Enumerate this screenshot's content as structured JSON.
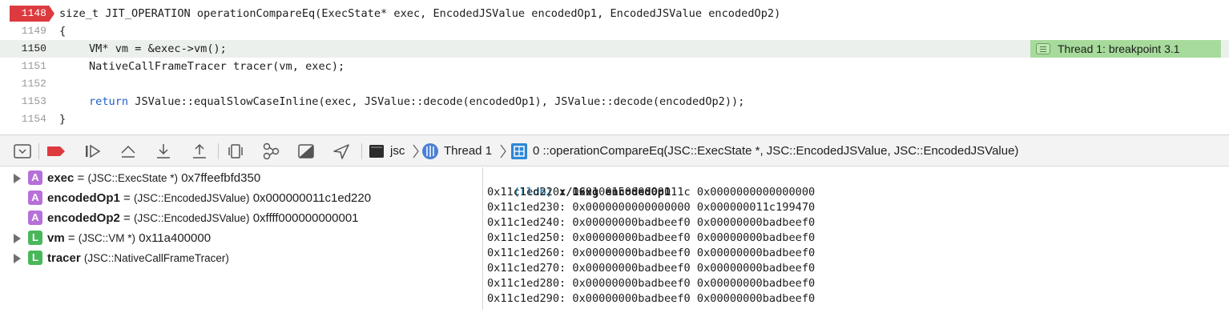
{
  "editor": {
    "breakpoint_line": "1148",
    "lines": [
      {
        "number": "1148",
        "text": "size_t JIT_OPERATION operationCompareEq(ExecState* exec, EncodedJSValue encodedOp1, EncodedJSValue encodedOp2)"
      },
      {
        "number": "1149",
        "text": "{"
      },
      {
        "number": "1150",
        "text": "VM* vm = &exec->vm();"
      },
      {
        "number": "1151",
        "text": "NativeCallFrameTracer tracer(vm, exec);"
      },
      {
        "number": "1152",
        "text": ""
      },
      {
        "number": "1153",
        "keyword": "return",
        "text": " JSValue::equalSlowCaseInline(exec, JSValue::decode(encodedOp1), JSValue::decode(encodedOp2));"
      },
      {
        "number": "1154",
        "text": "}"
      }
    ],
    "annotation": "Thread 1: breakpoint 3.1"
  },
  "debug_bar": {
    "buttons": [
      "hide-debug-area-icon",
      "breakpoints-toggle-icon",
      "continue-icon",
      "step-over-icon",
      "step-into-icon",
      "step-out-icon",
      "view-hierarchy-icon",
      "memory-graph-icon",
      "environment-overrides-icon",
      "simulate-location-icon"
    ],
    "breadcrumb": {
      "target": "jsc",
      "thread": "Thread 1",
      "frame": "0 ::operationCompareEq(JSC::ExecState *, JSC::EncodedJSValue, JSC::EncodedJSValue)"
    },
    "colors": {
      "breakpoint": "#dc3a3f",
      "thread_icon": "#4a7fd4",
      "frame_icon": "#2f86d6"
    }
  },
  "variables": [
    {
      "badge": "A",
      "name": "exec",
      "eq": " = ",
      "type": "(JSC::ExecState *)",
      "value": " 0x7ffeefbfd350",
      "expandable": true
    },
    {
      "badge": "A",
      "name": "encodedOp1",
      "eq": " = ",
      "type": "(JSC::EncodedJSValue)",
      "value": " 0x000000011c1ed220",
      "expandable": false
    },
    {
      "badge": "A",
      "name": "encodedOp2",
      "eq": " = ",
      "type": "(JSC::EncodedJSValue)",
      "value": " 0xffff000000000001",
      "expandable": false
    },
    {
      "badge": "L",
      "name": "vm",
      "eq": " = ",
      "type": "(JSC::VM *)",
      "value": " 0x11a400000",
      "expandable": true
    },
    {
      "badge": "L",
      "name": "tracer",
      "eq": " ",
      "type": "(JSC::NativeCallFrameTracer)",
      "value": "",
      "expandable": true
    }
  ],
  "console": {
    "prompt": "(lldb)",
    "command": " x/16xg encodedOp1",
    "output": [
      "0x11c1ed220: 0x010015000000011c 0x0000000000000000",
      "0x11c1ed230: 0x0000000000000000 0x000000011c199470",
      "0x11c1ed240: 0x00000000badbeef0 0x00000000badbeef0",
      "0x11c1ed250: 0x00000000badbeef0 0x00000000badbeef0",
      "0x11c1ed260: 0x00000000badbeef0 0x00000000badbeef0",
      "0x11c1ed270: 0x00000000badbeef0 0x00000000badbeef0",
      "0x11c1ed280: 0x00000000badbeef0 0x00000000badbeef0",
      "0x11c1ed290: 0x00000000badbeef0 0x00000000badbeef0"
    ]
  }
}
